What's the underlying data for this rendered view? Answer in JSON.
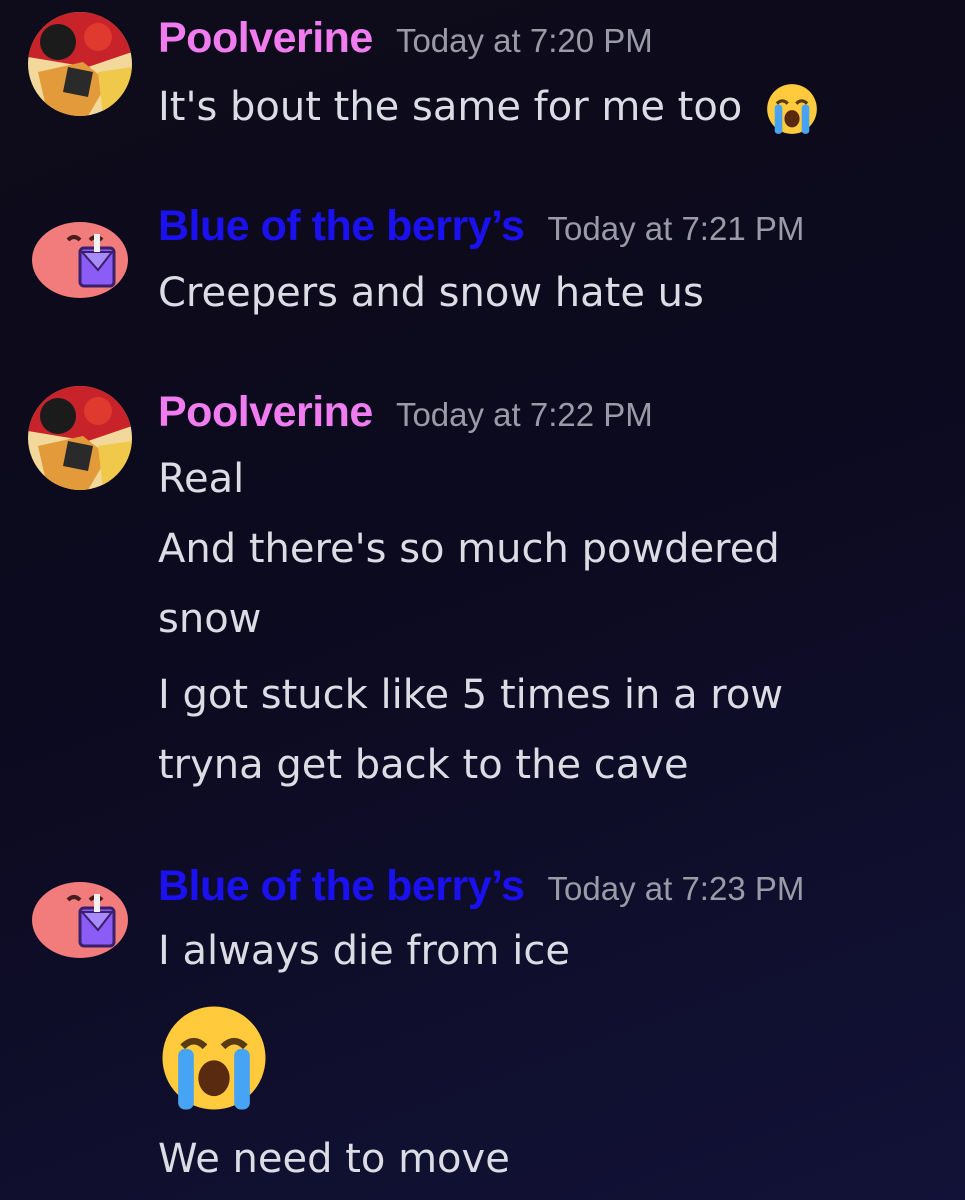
{
  "colors": {
    "poolverine": "#f07cf0",
    "blue_berry": "#1a10f0",
    "timestamp": "#9a9ba7",
    "text": "#dcdde4"
  },
  "messages": [
    {
      "author": "Poolverine",
      "avatar": "poolverine-avatar",
      "time": "Today at 7:20 PM",
      "lines": [
        "It's bout the same for me too"
      ],
      "inline_emoji": "loudly-crying-face-emoji"
    },
    {
      "author": "Blue of the berry’s",
      "avatar": "pink-blob-drinking-avatar",
      "time": "Today at 7:21 PM",
      "lines": [
        "Creepers and snow hate us"
      ]
    },
    {
      "author": "Poolverine",
      "avatar": "poolverine-avatar",
      "time": "Today at 7:22 PM",
      "lines": [
        "Real",
        "And there's so much powdered",
        "snow",
        "I got stuck like 5 times in a row",
        "tryna get back to the cave"
      ]
    },
    {
      "author": "Blue of the berry’s",
      "avatar": "pink-blob-drinking-avatar",
      "time": "Today at 7:23 PM",
      "lines": [
        "I always die from ice",
        "We need to move"
      ],
      "big_emoji": "loudly-crying-face-emoji"
    }
  ]
}
